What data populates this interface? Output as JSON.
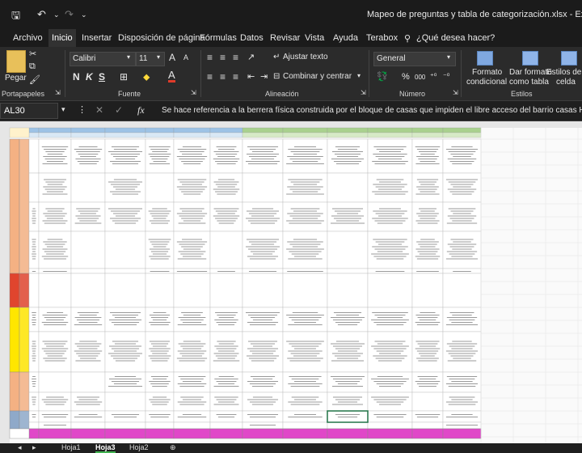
{
  "window": {
    "title": "Mapeo de preguntas y tabla de categorización.xlsx - Excel",
    "save_glyph": "🖫",
    "undo_glyph": "↶",
    "redo_glyph": "↷"
  },
  "menu": {
    "tabs": [
      "Archivo",
      "Inicio",
      "Insertar",
      "Disposición de página",
      "Fórmulas",
      "Datos",
      "Revisar",
      "Vista",
      "Ayuda",
      "Terabox"
    ],
    "tell_me": "¿Qué desea hacer?"
  },
  "ribbon": {
    "clipboard": {
      "paste": "Pegar",
      "label": "Portapapeles"
    },
    "font": {
      "name": "Calibri",
      "size": "11",
      "bold": "N",
      "italic": "K",
      "underline": "S",
      "grow": "A",
      "shrink": "A",
      "color": "A",
      "label": "Fuente"
    },
    "alignment": {
      "wrap": "Ajustar texto",
      "merge": "Combinar y centrar",
      "label": "Alineación"
    },
    "number": {
      "format": "General",
      "percent": "%",
      "thousands": "000",
      "label": "Número"
    },
    "styles": {
      "conditional": "Formato",
      "conditional2": "condicional",
      "table": "Dar formato",
      "table2": "como tabla",
      "cell": "Estilos de",
      "cell2": "celda",
      "label": "Estilos"
    }
  },
  "formula_bar": {
    "cell_ref": "AL30",
    "fx": "fx",
    "cancel": "✕",
    "enter": "✓",
    "content": "Se hace referencia a la berrera física construida por el bloque de casas que impiden el libre acceso del barrio casas Huertas al"
  },
  "sheets": {
    "tabs": [
      "Hoja1",
      "Hoja3",
      "Hoja2"
    ],
    "active": "Hoja3",
    "add": "⊕"
  },
  "colors": {
    "header_blue": "#9dc3e6",
    "header_green": "#a9d18e",
    "orange": "#f4b183",
    "yellow": "#ffe600",
    "red": "#e0452e",
    "steel": "#8fa9c9",
    "pink": "#e048c8",
    "cream": "#fff2cc",
    "selection": "#217346"
  }
}
